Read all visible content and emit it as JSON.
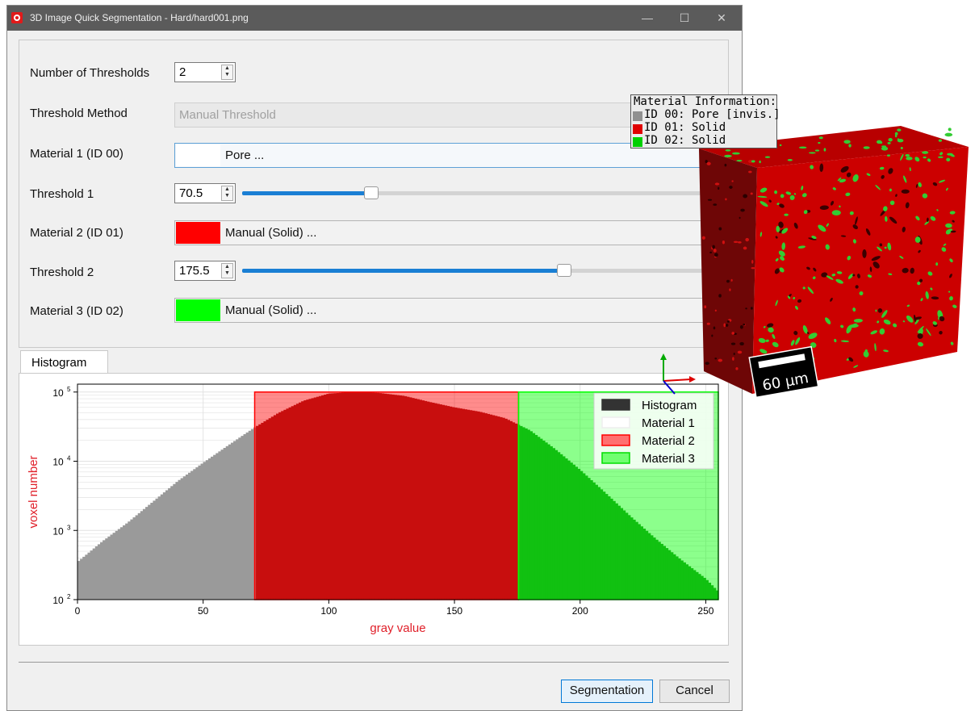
{
  "window": {
    "title": "3D Image Quick Segmentation - Hard/hard001.png",
    "minimize": "—",
    "maximize": "☐",
    "close": "✕"
  },
  "form": {
    "num_thresholds_label": "Number of Thresholds",
    "num_thresholds_value": "2",
    "threshold_method_label": "Threshold Method",
    "threshold_method_value": "Manual Threshold",
    "material1_label": "Material 1 (ID 00)",
    "material1_value": "Pore ...",
    "material1_color": "#ffffff",
    "threshold1_label": "Threshold 1",
    "threshold1_value": "70.5",
    "material2_label": "Material 2 (ID 01)",
    "material2_value": "Manual (Solid) ...",
    "material2_color": "#ff0000",
    "threshold2_label": "Threshold 2",
    "threshold2_value": "175.5",
    "material3_label": "Material 3 (ID 02)",
    "material3_value": "Manual (Solid) ...",
    "material3_color": "#00ff00",
    "slider_max": 255
  },
  "histogram_tab": "Histogram",
  "buttons": {
    "segmentation": "Segmentation",
    "cancel": "Cancel"
  },
  "chart_data": {
    "type": "area",
    "xlabel": "gray value",
    "ylabel": "voxel number",
    "xlim": [
      0,
      255
    ],
    "ylim": [
      100,
      130000
    ],
    "yscale": "log",
    "xticks": [
      "0",
      "50",
      "100",
      "150",
      "200",
      "250"
    ],
    "yticks": [
      "10^2",
      "10^3",
      "10^4",
      "10^5"
    ],
    "grid": true,
    "legend_position": "top-right",
    "legend": [
      "Histogram",
      "Material 1",
      "Material 2",
      "Material 3"
    ],
    "x": [
      0,
      10,
      20,
      30,
      40,
      50,
      60,
      70,
      80,
      90,
      100,
      110,
      120,
      130,
      140,
      150,
      160,
      170,
      180,
      190,
      200,
      210,
      220,
      230,
      240,
      250,
      255
    ],
    "values": [
      350,
      700,
      1300,
      2600,
      5200,
      9500,
      17000,
      30000,
      50000,
      75000,
      95000,
      100000,
      97000,
      88000,
      72000,
      60000,
      52000,
      42000,
      28000,
      15000,
      7500,
      3500,
      1600,
      760,
      380,
      200,
      130
    ],
    "regions": [
      {
        "name": "Material 2",
        "from": 70.5,
        "to": 175.5,
        "color": "#ff0000"
      },
      {
        "name": "Material 3",
        "from": 175.5,
        "to": 255,
        "color": "#00ff00"
      }
    ]
  },
  "view3d": {
    "info_title": "Material Information:",
    "info_lines": [
      {
        "text": "ID 00: Pore [invis.]",
        "color": "#909090"
      },
      {
        "text": "ID 01: Solid",
        "color": "#e00000"
      },
      {
        "text": "ID 02: Solid",
        "color": "#00d000"
      }
    ],
    "scale_bar": "60 µm",
    "solid_color": "#cc0000",
    "grain_color": "#33cc33"
  }
}
